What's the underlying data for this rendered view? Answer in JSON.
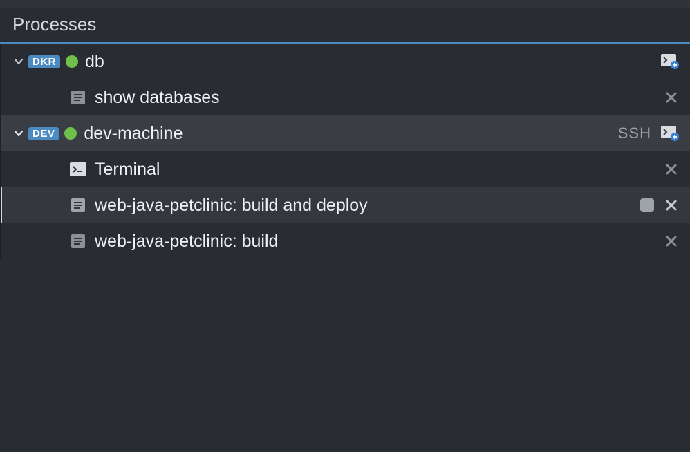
{
  "panel": {
    "title": "Processes"
  },
  "machines": [
    {
      "badge": "DKR",
      "status": "green",
      "name": "db",
      "ssh": false,
      "children": [
        {
          "type": "doc",
          "label": "show databases",
          "closable": true,
          "stoppable": false
        }
      ]
    },
    {
      "badge": "DEV",
      "status": "green",
      "name": "dev-machine",
      "ssh": true,
      "selected": true,
      "children": [
        {
          "type": "terminal",
          "label": "Terminal",
          "closable": true,
          "stoppable": false
        },
        {
          "type": "doc",
          "label": "web-java-petclinic: build and deploy",
          "closable": true,
          "stoppable": true,
          "highlight": true
        },
        {
          "type": "doc",
          "label": "web-java-petclinic: build",
          "closable": true,
          "stoppable": false
        }
      ]
    }
  ],
  "labels": {
    "ssh": "SSH"
  },
  "colors": {
    "accent": "#4a8cc2",
    "statusGreen": "#6ec04a"
  }
}
